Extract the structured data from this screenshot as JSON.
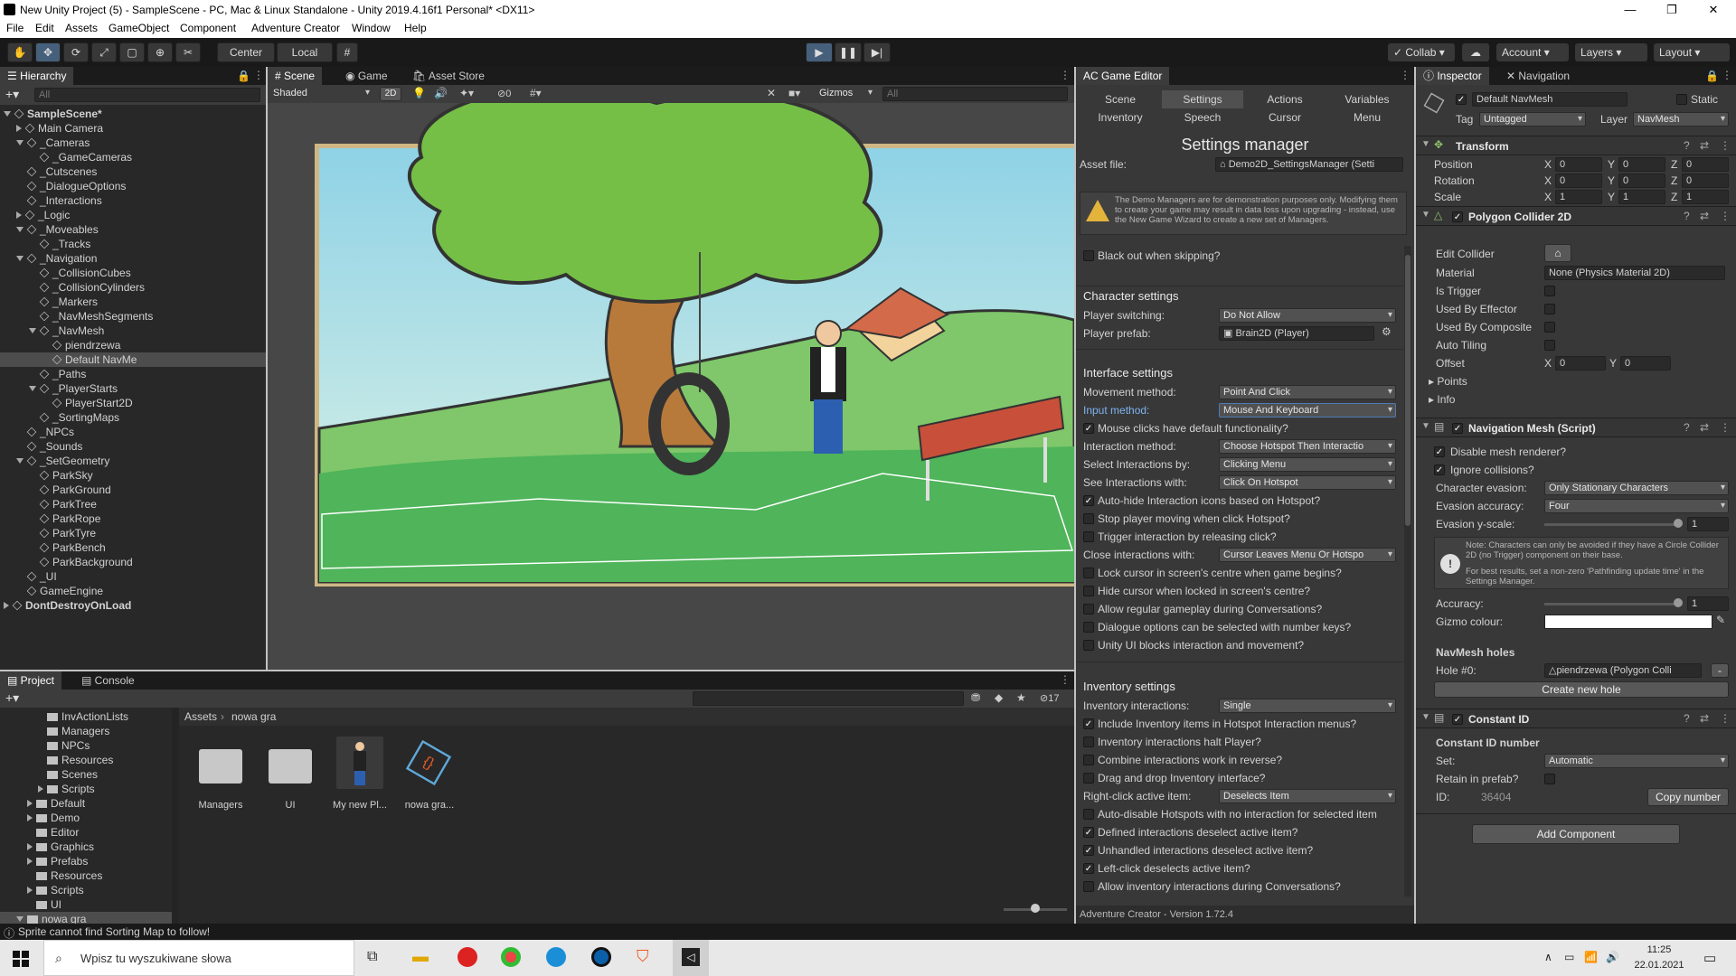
{
  "window": {
    "title": "New Unity Project (5) - SampleScene - PC, Mac & Linux Standalone - Unity 2019.4.16f1 Personal* <DX11>"
  },
  "menu": [
    "File",
    "Edit",
    "Assets",
    "GameObject",
    "Component",
    "Adventure Creator",
    "Window",
    "Help"
  ],
  "toolbar": {
    "pivot": "Center",
    "space": "Local",
    "collab": "Collab",
    "account": "Account",
    "layers": "Layers",
    "layout": "Layout"
  },
  "hierarchy": {
    "tab": "Hierarchy",
    "search_placeholder": "All",
    "items": [
      {
        "label": "SampleScene*",
        "depth": 0,
        "type": "scene",
        "fold": "open"
      },
      {
        "label": "Main Camera",
        "depth": 1,
        "type": "go",
        "fold": "closed"
      },
      {
        "label": "_Cameras",
        "depth": 1,
        "type": "go",
        "fold": "open"
      },
      {
        "label": "_GameCameras",
        "depth": 2,
        "type": "go",
        "fold": "none"
      },
      {
        "label": "_Cutscenes",
        "depth": 1,
        "type": "go",
        "fold": "none"
      },
      {
        "label": "_DialogueOptions",
        "depth": 1,
        "type": "go",
        "fold": "none"
      },
      {
        "label": "_Interactions",
        "depth": 1,
        "type": "go",
        "fold": "none"
      },
      {
        "label": "_Logic",
        "depth": 1,
        "type": "go",
        "fold": "closed"
      },
      {
        "label": "_Moveables",
        "depth": 1,
        "type": "go",
        "fold": "open"
      },
      {
        "label": "_Tracks",
        "depth": 2,
        "type": "go",
        "fold": "none"
      },
      {
        "label": "_Navigation",
        "depth": 1,
        "type": "go",
        "fold": "open"
      },
      {
        "label": "_CollisionCubes",
        "depth": 2,
        "type": "go",
        "fold": "none"
      },
      {
        "label": "_CollisionCylinders",
        "depth": 2,
        "type": "go",
        "fold": "none"
      },
      {
        "label": "_Markers",
        "depth": 2,
        "type": "go",
        "fold": "none"
      },
      {
        "label": "_NavMeshSegments",
        "depth": 2,
        "type": "go",
        "fold": "none"
      },
      {
        "label": "_NavMesh",
        "depth": 2,
        "type": "go",
        "fold": "open"
      },
      {
        "label": "piendrzewa",
        "depth": 3,
        "type": "go",
        "fold": "none"
      },
      {
        "label": "Default NavMe",
        "depth": 3,
        "type": "go",
        "fold": "none",
        "selected": true
      },
      {
        "label": "_Paths",
        "depth": 2,
        "type": "go",
        "fold": "none"
      },
      {
        "label": "_PlayerStarts",
        "depth": 2,
        "type": "go",
        "fold": "open"
      },
      {
        "label": "PlayerStart2D",
        "depth": 3,
        "type": "go",
        "fold": "none"
      },
      {
        "label": "_SortingMaps",
        "depth": 2,
        "type": "go",
        "fold": "none"
      },
      {
        "label": "_NPCs",
        "depth": 1,
        "type": "go",
        "fold": "none"
      },
      {
        "label": "_Sounds",
        "depth": 1,
        "type": "go",
        "fold": "none"
      },
      {
        "label": "_SetGeometry",
        "depth": 1,
        "type": "go",
        "fold": "open"
      },
      {
        "label": "ParkSky",
        "depth": 2,
        "type": "go",
        "fold": "none"
      },
      {
        "label": "ParkGround",
        "depth": 2,
        "type": "go",
        "fold": "none"
      },
      {
        "label": "ParkTree",
        "depth": 2,
        "type": "go",
        "fold": "none"
      },
      {
        "label": "ParkRope",
        "depth": 2,
        "type": "go",
        "fold": "none"
      },
      {
        "label": "ParkTyre",
        "depth": 2,
        "type": "go",
        "fold": "none"
      },
      {
        "label": "ParkBench",
        "depth": 2,
        "type": "go",
        "fold": "none"
      },
      {
        "label": "ParkBackground",
        "depth": 2,
        "type": "go",
        "fold": "none"
      },
      {
        "label": "_UI",
        "depth": 1,
        "type": "go",
        "fold": "none"
      },
      {
        "label": "GameEngine",
        "depth": 1,
        "type": "go",
        "fold": "none"
      },
      {
        "label": "DontDestroyOnLoad",
        "depth": 0,
        "type": "scene",
        "fold": "closed"
      }
    ]
  },
  "scene": {
    "tabs": [
      "Scene",
      "Game",
      "Asset Store"
    ],
    "shading": "Shaded",
    "mode2d": "2D",
    "hidden_count": "0",
    "gizmos": "Gizmos",
    "search_placeholder": "All"
  },
  "project": {
    "tabs": [
      "Project",
      "Console"
    ],
    "hidden_count": "17",
    "tree": [
      {
        "label": "InvActionLists",
        "depth": 2,
        "fold": "none"
      },
      {
        "label": "Managers",
        "depth": 2,
        "fold": "none"
      },
      {
        "label": "NPCs",
        "depth": 2,
        "fold": "none"
      },
      {
        "label": "Resources",
        "depth": 2,
        "fold": "none"
      },
      {
        "label": "Scenes",
        "depth": 2,
        "fold": "none"
      },
      {
        "label": "Scripts",
        "depth": 2,
        "fold": "closed"
      },
      {
        "label": "Default",
        "depth": 1,
        "fold": "closed"
      },
      {
        "label": "Demo",
        "depth": 1,
        "fold": "closed"
      },
      {
        "label": "Editor",
        "depth": 1,
        "fold": "none"
      },
      {
        "label": "Graphics",
        "depth": 1,
        "fold": "closed"
      },
      {
        "label": "Prefabs",
        "depth": 1,
        "fold": "closed"
      },
      {
        "label": "Resources",
        "depth": 1,
        "fold": "none"
      },
      {
        "label": "Scripts",
        "depth": 1,
        "fold": "closed"
      },
      {
        "label": "UI",
        "depth": 1,
        "fold": "none"
      },
      {
        "label": "nowa gra",
        "depth": 0,
        "fold": "open",
        "selected": true
      }
    ],
    "breadcrumb": [
      "Assets",
      "nowa gra"
    ],
    "assets": [
      {
        "label": "Managers",
        "kind": "folder"
      },
      {
        "label": "UI",
        "kind": "folder"
      },
      {
        "label": "My new Pl...",
        "kind": "prefab"
      },
      {
        "label": "nowa gra...",
        "kind": "script"
      }
    ]
  },
  "status": {
    "message": "Sprite cannot find Sorting Map to follow!"
  },
  "ac_editor": {
    "tab": "AC Game Editor",
    "tabs_row1": [
      "Scene",
      "Settings",
      "Actions",
      "Variables"
    ],
    "tabs_row2": [
      "Inventory",
      "Speech",
      "Cursor",
      "Menu"
    ],
    "active_tab": "Settings",
    "title": "Settings manager",
    "asset_file_label": "Asset file:",
    "asset_file_value": "Demo2D_SettingsManager (Setti",
    "warning": "The Demo Managers are for demonstration purposes only. Modifying them to create your game may result in data loss upon upgrading - instead, use the New Game Wizard to create a new set of Managers.",
    "blackout": {
      "label": "Black out when skipping?",
      "checked": false
    },
    "character": {
      "header": "Character settings",
      "switching_label": "Player switching:",
      "switching_value": "Do Not Allow",
      "prefab_label": "Player prefab:",
      "prefab_value": "Brain2D (Player)"
    },
    "interface": {
      "header": "Interface settings",
      "movement_label": "Movement method:",
      "movement_value": "Point And Click",
      "input_label": "Input method:",
      "input_value": "Mouse And Keyboard",
      "mouse_default": {
        "label": "Mouse clicks have default functionality?",
        "checked": true
      },
      "interaction_label": "Interaction method:",
      "interaction_value": "Choose Hotspot Then Interactio",
      "select_label": "Select Interactions by:",
      "select_value": "Clicking Menu",
      "see_label": "See Interactions with:",
      "see_value": "Click On Hotspot",
      "autohide": {
        "label": "Auto-hide Interaction icons based on Hotspot?",
        "checked": true
      },
      "stopmove": {
        "label": "Stop player moving when click Hotspot?",
        "checked": false
      },
      "trigger": {
        "label": "Trigger interaction by releasing click?",
        "checked": false
      },
      "close_label": "Close interactions with:",
      "close_value": "Cursor Leaves Menu Or Hotspo",
      "checks": [
        {
          "label": "Lock cursor in screen's centre when game begins?",
          "checked": false
        },
        {
          "label": "Hide cursor when locked in screen's centre?",
          "checked": false
        },
        {
          "label": "Allow regular gameplay during Conversations?",
          "checked": false
        },
        {
          "label": "Dialogue options can be selected with number keys?",
          "checked": false
        },
        {
          "label": "Unity UI blocks interaction and movement?",
          "checked": false
        }
      ]
    },
    "inventory": {
      "header": "Inventory settings",
      "interactions_label": "Inventory interactions:",
      "interactions_value": "Single",
      "checks1": [
        {
          "label": "Include Inventory items in Hotspot Interaction menus?",
          "checked": true
        },
        {
          "label": "Inventory interactions halt Player?",
          "checked": false
        },
        {
          "label": "Combine interactions work in reverse?",
          "checked": false
        },
        {
          "label": "Drag and drop Inventory interface?",
          "checked": false
        }
      ],
      "rightclick_label": "Right-click active item:",
      "rightclick_value": "Deselects Item",
      "checks2": [
        {
          "label": "Auto-disable Hotspots with no interaction for selected item",
          "checked": false
        },
        {
          "label": "Defined interactions deselect active item?",
          "checked": true
        },
        {
          "label": "Unhandled interactions deselect active item?",
          "checked": true
        },
        {
          "label": "Left-click deselects active item?",
          "checked": true
        },
        {
          "label": "Allow inventory interactions during Conversations?",
          "checked": false
        }
      ]
    },
    "version": "Adventure Creator - Version 1.72.4"
  },
  "inspector": {
    "tabs": [
      "Inspector",
      "Navigation"
    ],
    "object_name": "Default NavMesh",
    "static_label": "Static",
    "tag_label": "Tag",
    "tag_value": "Untagged",
    "layer_label": "Layer",
    "layer_value": "NavMesh",
    "transform": {
      "title": "Transform",
      "rows": [
        {
          "label": "Position",
          "x": "0",
          "y": "0",
          "z": "0"
        },
        {
          "label": "Rotation",
          "x": "0",
          "y": "0",
          "z": "0"
        },
        {
          "label": "Scale",
          "x": "1",
          "y": "1",
          "z": "1"
        }
      ]
    },
    "polygon": {
      "title": "Polygon Collider 2D",
      "edit_label": "Edit Collider",
      "material_label": "Material",
      "material_value": "None (Physics Material 2D)",
      "is_trigger": "Is Trigger",
      "used_by_effector": "Used By Effector",
      "used_by_composite": "Used By Composite",
      "auto_tiling": "Auto Tiling",
      "offset_label": "Offset",
      "offset_x": "0",
      "offset_y": "0",
      "points": "Points",
      "info": "Info"
    },
    "navmesh": {
      "title": "Navigation Mesh (Script)",
      "disable_renderer": "Disable mesh renderer?",
      "ignore_collisions": "Ignore collisions?",
      "evasion_label": "Character evasion:",
      "evasion_value": "Only Stationary Characters",
      "accuracy_label": "Evasion accuracy:",
      "accuracy_value": "Four",
      "yscale_label": "Evasion y-scale:",
      "yscale_value": "1",
      "note1": "Note: Characters can only be avoided if they have a Circle Collider 2D (no Trigger) component on their base.",
      "note2": "For best results, set a non-zero 'Pathfinding update time' in the Settings Manager.",
      "acc_label": "Accuracy:",
      "acc_value": "1",
      "gizmo_label": "Gizmo colour:",
      "holes_header": "NavMesh holes",
      "hole_label": "Hole #0:",
      "hole_value": "piendrzewa (Polygon Colli",
      "create_hole": "Create new hole"
    },
    "constant_id": {
      "title": "Constant ID",
      "header": "Constant ID number",
      "set_label": "Set:",
      "set_value": "Automatic",
      "retain_label": "Retain in prefab?",
      "id_label": "ID:",
      "id_value": "36404",
      "copy_button": "Copy number"
    },
    "add_component": "Add Component"
  },
  "taskbar": {
    "search_placeholder": "Wpisz tu wyszukiwane słowa",
    "time": "11:25",
    "date": "22.01.2021"
  }
}
